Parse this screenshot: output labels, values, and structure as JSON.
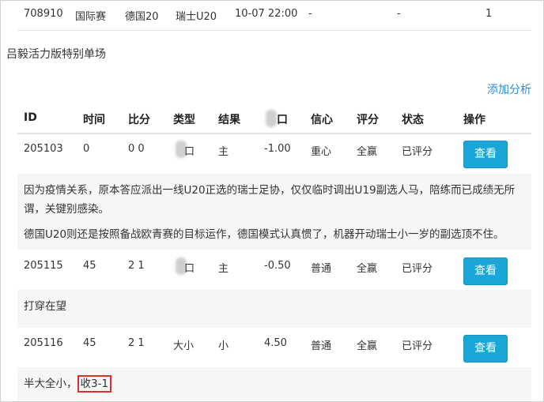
{
  "top_row": {
    "id": "708910",
    "league": "国际赛",
    "home": "德国20",
    "away": "瑞士U20",
    "time": "10-07 22:00",
    "col_a": "-",
    "col_b": "-",
    "col_c": "1"
  },
  "section_title": "吕毅活力版特别单场",
  "add_analysis_label": "添加分析",
  "table": {
    "headers": [
      "ID",
      "时间",
      "比分",
      "类型",
      "结果",
      "",
      "信心",
      "评分",
      "状态",
      "操作"
    ],
    "header_partial_type": "口",
    "rows": [
      {
        "id": "205103",
        "time": "0",
        "score": "0 0",
        "type_partial": "口",
        "result": "主",
        "value": "-1.00",
        "confidence": "重心",
        "rating": "全赢",
        "status": "已评分",
        "action": "查看",
        "note": [
          "因为疫情关系，原本答应派出一线U20正选的瑞士足协，仅仅临时调出U19副选人马，陪练而已成绩无所",
          "谓，关键别感染。",
          "德国U20则还是按照备战欧青赛的目标运作，德国模式认真惯了，机器开动瑞士小一岁的副选顶不住。"
        ]
      },
      {
        "id": "205115",
        "time": "45",
        "score": "2 1",
        "type_partial": "口",
        "result": "主",
        "value": "-0.50",
        "confidence": "普通",
        "rating": "全赢",
        "status": "已评分",
        "action": "查看",
        "note": [
          "打穿在望"
        ]
      },
      {
        "id": "205116",
        "time": "45",
        "score": "2 1",
        "type": "大小",
        "result": "小",
        "value": "4.50",
        "confidence": "普通",
        "rating": "全赢",
        "status": "已评分",
        "action": "查看",
        "note_prefix": "半大全小，",
        "note_boxed": "收3-1"
      }
    ]
  },
  "colors": {
    "button": "#1aa6d6",
    "link": "#2a8fd8",
    "highlight_box": "#d9302b"
  }
}
